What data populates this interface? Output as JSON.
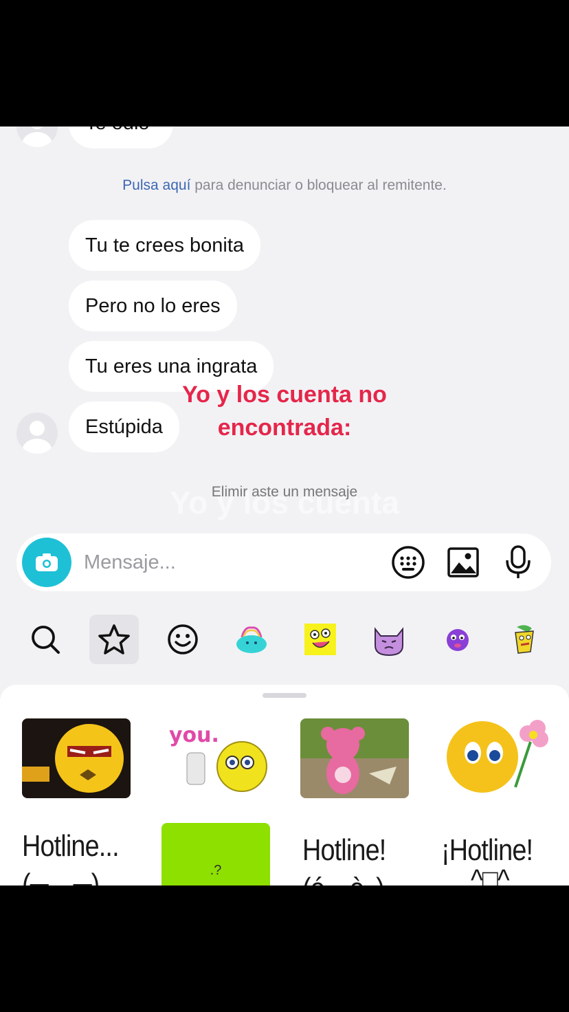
{
  "chat": {
    "top_partial_message": "Te odio",
    "report_link": "Pulsa aquí",
    "report_rest": " para denunciar o bloquear al remitente.",
    "messages": [
      "Tu te crees bonita",
      "Pero no lo eres",
      "Tu eres una ingrata",
      "Estúpida"
    ],
    "deleted_notice": "Elimir aste un mensaje"
  },
  "overlay": {
    "caption_line1": "Yo y los cuenta no",
    "caption_line2": "encontrada:",
    "ghost_caption": "Yo y los cuenta"
  },
  "composer": {
    "placeholder": "Mensaje...",
    "accent_color": "#1ec0d6"
  },
  "sticker_tabs": [
    {
      "icon": "search-icon"
    },
    {
      "icon": "star-icon",
      "active": true
    },
    {
      "icon": "smiley-icon"
    },
    {
      "icon": "cyan-blob-sticker-icon"
    },
    {
      "icon": "yellow-sponge-sticker-icon"
    },
    {
      "icon": "purple-cat-sticker-icon"
    },
    {
      "icon": "purple-emoji-sticker-icon"
    },
    {
      "icon": "yellow-creature-sticker-icon"
    }
  ],
  "stickers": {
    "hotline_1": "Hotline...",
    "hotline_1_sub": "(╥﹏╥)",
    "green_sticker_text": ".?",
    "hotline_2": "Hotline!",
    "hotline_2_sub": "(ó﹏ò。)",
    "hotline_3": "¡Hotline!",
    "hotline_3_sub": "^□^"
  }
}
